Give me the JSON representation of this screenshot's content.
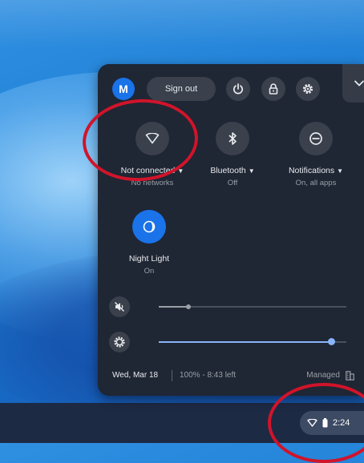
{
  "account": {
    "avatar_letter": "M"
  },
  "top_buttons": {
    "sign_out_label": "Sign out"
  },
  "tiles": [
    {
      "label": "Not connected",
      "sub": "No networks",
      "icon": "wifi-icon",
      "active": false
    },
    {
      "label": "Bluetooth",
      "sub": "Off",
      "icon": "bluetooth-icon",
      "active": false
    },
    {
      "label": "Notifications",
      "sub": "On, all apps",
      "icon": "notifications-icon",
      "active": false
    },
    {
      "label": "Night Light",
      "sub": "On",
      "icon": "night-light-icon",
      "active": true
    }
  ],
  "sliders": {
    "volume": {
      "level": 0.16,
      "muted": true,
      "icon": "volume-muted-icon"
    },
    "brightness": {
      "level": 0.92,
      "icon": "brightness-icon"
    }
  },
  "footer": {
    "date": "Wed, Mar 18",
    "battery": "100% - 8:43 left",
    "managed": "Managed"
  },
  "tray": {
    "time": "2:24"
  },
  "colors": {
    "accent": "#8ab4f8",
    "panel": "#1f2634",
    "annotation": "#d0142a"
  }
}
